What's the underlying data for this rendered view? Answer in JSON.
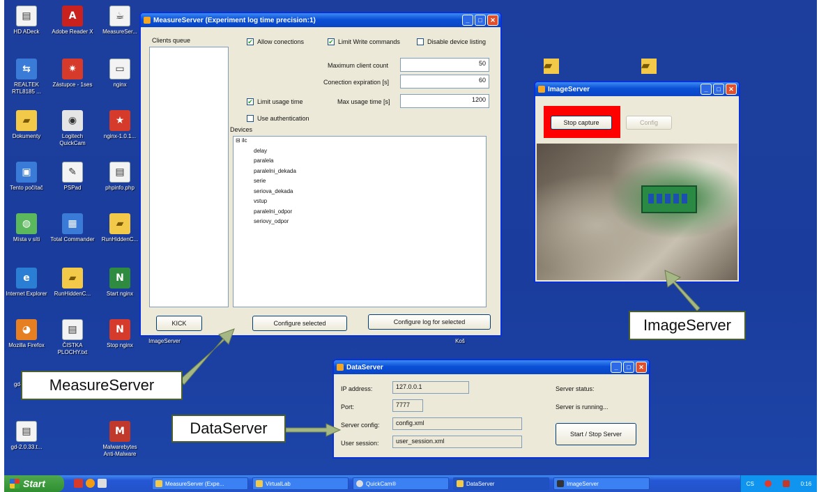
{
  "desktop": {
    "icons": [
      {
        "label": "HD ADeck",
        "icon": "doc-icon"
      },
      {
        "label": "Adobe Reader X",
        "icon": "pdf-icon"
      },
      {
        "label": "MeasureSer...",
        "icon": "java-icon"
      },
      {
        "label": "REALTEK RTL8185 ...",
        "icon": "network-icon"
      },
      {
        "label": "Zástupce - 1ses",
        "icon": "shortcut-icon"
      },
      {
        "label": "nginx",
        "icon": "app-icon"
      },
      {
        "label": "Dokumenty",
        "icon": "folder-icon"
      },
      {
        "label": "Logitech QuickCam",
        "icon": "camera-icon"
      },
      {
        "label": "nginx-1.0.1...",
        "icon": "star-icon"
      },
      {
        "label": "Tento počítač",
        "icon": "computer-icon"
      },
      {
        "label": "PSPad",
        "icon": "editor-icon"
      },
      {
        "label": "phpinfo.php",
        "icon": "doc-icon"
      },
      {
        "label": "Místa v síti",
        "icon": "network-places-icon"
      },
      {
        "label": "Total Commander",
        "icon": "disk-icon"
      },
      {
        "label": "RunHiddenC...",
        "icon": "folder-icon"
      },
      {
        "label": "Internet Explorer",
        "icon": "ie-icon"
      },
      {
        "label": "RunHiddenC...",
        "icon": "folder-icon"
      },
      {
        "label": "Start nginx",
        "icon": "start-icon"
      },
      {
        "label": "Mozilla Firefox",
        "icon": "firefox-icon"
      },
      {
        "label": "ČISTKA PLOCHY.txt",
        "icon": "text-file-icon"
      },
      {
        "label": "Stop nginx",
        "icon": "stop-icon"
      },
      {
        "label": "ImageServer",
        "icon": "image-server-icon"
      },
      {
        "label": "gd-2",
        "icon": "doc-icon"
      },
      {
        "label": "gd-2.0.33.t...",
        "icon": "doc-icon"
      },
      {
        "label": "Malwarebytes Anti-Malware",
        "icon": "malware-icon"
      },
      {
        "label": "Koš",
        "icon": "trash-icon"
      }
    ]
  },
  "measure": {
    "title": "MeasureServer (Experiment log time precision:1)",
    "clients_label": "Clients queue",
    "allow_connections": "Allow conections",
    "limit_write": "Limit Write commands",
    "disable_listing": "Disable device listing",
    "max_client_label": "Maximum client count",
    "max_client_value": "50",
    "expiration_label": "Conection expiration [s]",
    "expiration_value": "60",
    "limit_usage": "Limit usage time",
    "max_usage_label": "Max usage time [s]",
    "max_usage_value": "1200",
    "use_auth": "Use authentication",
    "devices_label": "Devices",
    "tree_root": "ilc",
    "devices": [
      "delay",
      "paralela",
      "paralelni_dekada",
      "serie",
      "seriova_dekada",
      "vstup",
      "paralelni_odpor",
      "seriovy_odpor"
    ],
    "kick": "KICK",
    "configure_selected": "Configure selected",
    "configure_log": "Configure log for selected"
  },
  "image": {
    "title": "ImageServer",
    "stop_capture": "Stop capture",
    "config": "Config"
  },
  "data": {
    "title": "DataServer",
    "ip_label": "IP address:",
    "ip_value": "127.0.0.1",
    "port_label": "Port:",
    "port_value": "7777",
    "server_config_label": "Server config:",
    "server_config_value": "config.xml",
    "user_session_label": "User session:",
    "user_session_value": "user_session.xml",
    "status_label": "Server status:",
    "status_value": "Server is running...",
    "start_stop": "Start / Stop Server"
  },
  "taskbar": {
    "start": "Start",
    "items": [
      "MeasureServer (Expe...",
      "VirtualLab",
      "QuickCam®",
      "DataServer",
      "ImageServer"
    ],
    "lang": "CS",
    "clock": "0:16"
  },
  "callouts": {
    "measure": "MeasureServer",
    "data": "DataServer",
    "image": "ImageServer"
  },
  "colors": {
    "desktop": "#1a3d9d",
    "highlight": "#ff0000",
    "callout_border": "#4a5e2e",
    "arrow": "#a5b784"
  }
}
